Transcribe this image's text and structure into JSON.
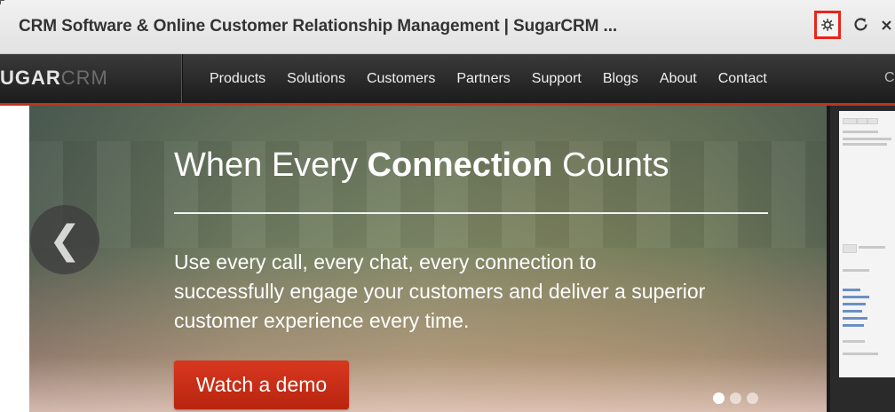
{
  "window": {
    "title": "CRM Software & Online Customer Relationship Management | SugarCRM ...",
    "buttons": {
      "settings": "gear-icon",
      "reload": "reload-icon",
      "close": "close-icon"
    },
    "highlight_color": "#e8251a"
  },
  "site_nav": {
    "logo": {
      "part1": "UGAR",
      "part2": "CRM"
    },
    "links": [
      "Products",
      "Solutions",
      "Customers",
      "Partners",
      "Support",
      "Blogs",
      "About",
      "Contact"
    ],
    "extra": "C",
    "accent_color": "#c2331c"
  },
  "hero": {
    "title_pre": "When Every ",
    "title_bold": "Connection",
    "title_post": " Counts",
    "body": "Use every call, every chat, every connection to successfully engage your customers and deliver a superior customer experience every time.",
    "cta": "Watch a demo",
    "cta_color": "#c92e17",
    "prev_icon": "chevron-left-icon",
    "prev_glyph": "❮",
    "carousel": {
      "total": 3,
      "active": 1
    }
  }
}
